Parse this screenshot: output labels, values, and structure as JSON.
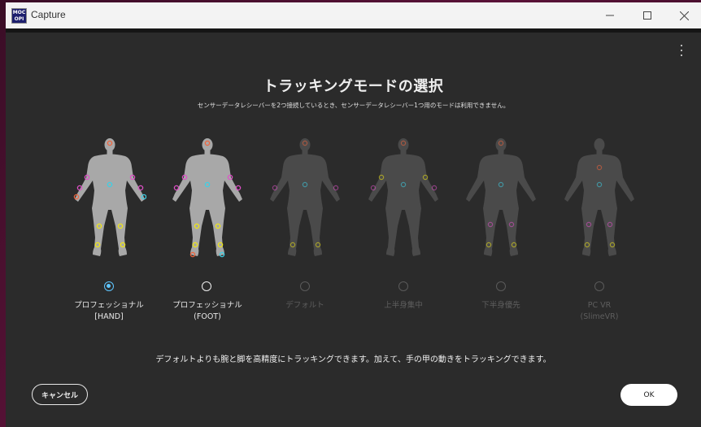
{
  "window": {
    "title": "Capture",
    "app_icon_text_1": "MOC",
    "app_icon_text_2": "OPI"
  },
  "dialog": {
    "heading": "トラッキングモードの選択",
    "subheading": "センサーデータレシーバーを2つ接続しているとき、センサーデータレシーバー1つ用のモードは利用できません。",
    "description": "デフォルトよりも腕と脚を高精度にトラッキングできます。加えて、手の甲の動きをトラッキングできます。",
    "cancel_label": "キャンセル",
    "ok_label": "OK"
  },
  "modes": [
    {
      "line1": "プロフェッショナル",
      "line2": "[HAND]",
      "state": "selected"
    },
    {
      "line1": "プロフェッショナル",
      "line2": "(FOOT)",
      "state": "available"
    },
    {
      "line1": "デフォルト",
      "line2": "",
      "state": "disabled"
    },
    {
      "line1": "上半身集中",
      "line2": "",
      "state": "disabled"
    },
    {
      "line1": "下半身優先",
      "line2": "",
      "state": "disabled"
    },
    {
      "line1": "PC VR",
      "line2": "(SlimeVR)",
      "state": "disabled"
    }
  ],
  "colors": {
    "accent_radio": "#5fc6ff",
    "sensor_orange": "#f0643c",
    "sensor_magenta": "#e050c8",
    "sensor_cyan": "#3cd0e6",
    "sensor_yellow": "#f0e614"
  }
}
